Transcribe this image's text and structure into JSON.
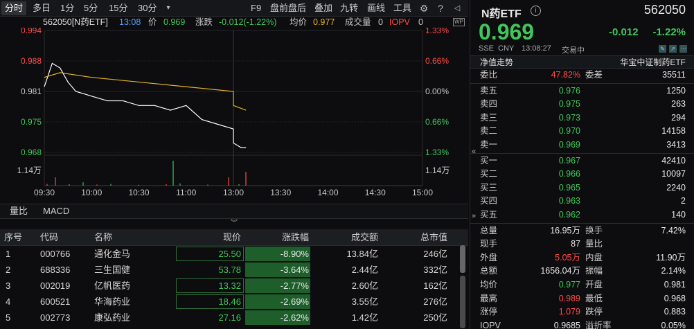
{
  "toolbar": {
    "tabs": [
      "分时",
      "多日",
      "1分",
      "5分",
      "15分",
      "30分"
    ],
    "dropdown_icon": "chevron-down",
    "tools": [
      "F9",
      "盘前盘后",
      "叠加",
      "九转",
      "画线",
      "工具"
    ]
  },
  "info": {
    "code_name": "562050[N药ETF]",
    "time": "13:08",
    "price_label": "价",
    "price": "0.969",
    "chg_label": "涨跌",
    "chg": "-0.012(-1.22%)",
    "avg_label": "均价",
    "avg": "0.977",
    "vol_label": "成交量",
    "vol": "0",
    "iopv_label": "IOPV",
    "iopv": "0"
  },
  "chart": {
    "y_labels": [
      "0.994",
      "0.988",
      "0.981",
      "0.975",
      "0.968"
    ],
    "pct_labels": [
      "1.33%",
      "0.66%",
      "0.00%",
      "0.66%",
      "1.33%"
    ],
    "vol_label": "1.14万",
    "x_labels": [
      "09:30",
      "10:00",
      "10:30",
      "11:00",
      "13:00",
      "13:30",
      "14:00",
      "14:30",
      "15:00"
    ],
    "colors": {
      "price": "#ffffff",
      "avg": "#e6b422",
      "red": "#ff4a4a",
      "green": "#3fc75a"
    }
  },
  "chart_data": {
    "type": "line",
    "series": [
      {
        "name": "价",
        "x": [
          "09:30",
          "09:35",
          "09:40",
          "09:45",
          "09:50",
          "10:00",
          "10:10",
          "10:20",
          "10:30",
          "10:40",
          "10:50",
          "11:00",
          "11:10",
          "11:20",
          "11:30",
          "13:00",
          "13:05",
          "13:08"
        ],
        "values": [
          0.982,
          0.987,
          0.986,
          0.983,
          0.981,
          0.98,
          0.979,
          0.979,
          0.978,
          0.978,
          0.977,
          0.978,
          0.975,
          0.974,
          0.973,
          0.97,
          0.969,
          0.969
        ]
      },
      {
        "name": "均价",
        "x": [
          "09:30",
          "09:40",
          "10:00",
          "10:30",
          "11:00",
          "11:30",
          "13:00",
          "13:08"
        ],
        "values": [
          0.984,
          0.985,
          0.984,
          0.983,
          0.982,
          0.981,
          0.978,
          0.977
        ]
      }
    ],
    "ylim": [
      0.968,
      0.994
    ]
  },
  "subtabs": [
    "量比",
    "MACD"
  ],
  "table": {
    "headers": [
      "序号",
      "代码",
      "名称",
      "现价",
      "涨跌幅",
      "成交额",
      "总市值"
    ],
    "rows": [
      [
        "1",
        "000766",
        "通化金马",
        "25.50",
        "-8.90%",
        "13.84亿",
        "246亿"
      ],
      [
        "2",
        "688336",
        "三生国健",
        "53.78",
        "-3.64%",
        "2.44亿",
        "332亿"
      ],
      [
        "3",
        "002019",
        "亿帆医药",
        "13.32",
        "-2.77%",
        "2.60亿",
        "162亿"
      ],
      [
        "4",
        "600521",
        "华海药业",
        "18.46",
        "-2.69%",
        "3.55亿",
        "276亿"
      ],
      [
        "5",
        "002773",
        "康弘药业",
        "27.16",
        "-2.62%",
        "1.42亿",
        "250亿"
      ]
    ]
  },
  "quote": {
    "name": "N药ETF",
    "code": "562050",
    "price": "0.969",
    "chg": "-0.012",
    "pct": "-1.22%",
    "exch": "SSE",
    "cur": "CNY",
    "time": "13:08:27",
    "status": "交易中",
    "nav_label": "净值走势",
    "index_name": "华宝中证制药ETF",
    "wb_label": "委比",
    "wb": "47.82%",
    "wc_label": "委差",
    "wc": "35511",
    "asks": [
      [
        "卖五",
        "0.976",
        "1250"
      ],
      [
        "卖四",
        "0.975",
        "263"
      ],
      [
        "卖三",
        "0.973",
        "294"
      ],
      [
        "卖二",
        "0.970",
        "14158"
      ],
      [
        "卖一",
        "0.969",
        "3413"
      ]
    ],
    "bids": [
      [
        "买一",
        "0.967",
        "42410"
      ],
      [
        "买二",
        "0.966",
        "10097"
      ],
      [
        "买三",
        "0.965",
        "2240"
      ],
      [
        "买四",
        "0.963",
        "2"
      ],
      [
        "买五",
        "0.962",
        "140"
      ]
    ],
    "stats": [
      [
        "总量",
        "16.95万",
        "换手",
        "7.42%"
      ],
      [
        "现手",
        "87",
        "量比",
        ""
      ],
      [
        "外盘",
        "5.05万",
        "内盘",
        "11.90万"
      ],
      [
        "总额",
        "1656.04万",
        "振幅",
        "2.14%"
      ],
      [
        "均价",
        "0.977",
        "开盘",
        "0.981"
      ],
      [
        "最高",
        "0.989",
        "最低",
        "0.968"
      ],
      [
        "涨停",
        "1.079",
        "跌停",
        "0.883"
      ],
      [
        "IOPV",
        "0.9685",
        "溢折率",
        "0.05%"
      ]
    ]
  }
}
